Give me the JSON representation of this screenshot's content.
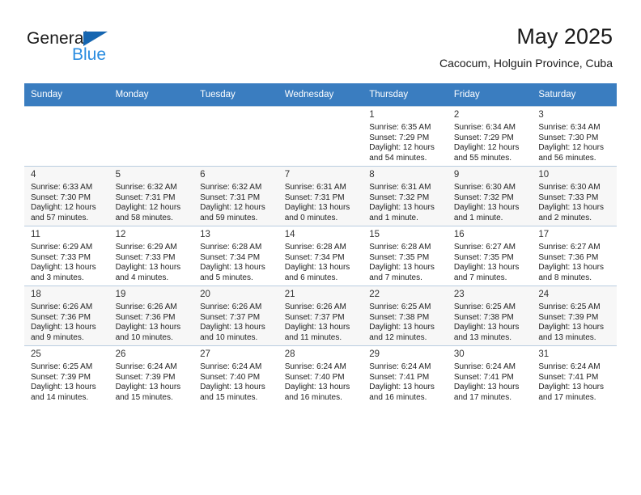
{
  "brand": {
    "line1": "General",
    "line2": "Blue",
    "triangle_color": "#1565b0",
    "blue_color": "#2a8ce0"
  },
  "header": {
    "title": "May 2025",
    "subtitle": "Cacocum, Holguin Province, Cuba"
  },
  "theme": {
    "header_bg": "#3a7dc0",
    "header_text": "#ffffff",
    "row_alt_bg": "#f7f7f7",
    "cell_border": "#b9cde0"
  },
  "weekdays": [
    "Sunday",
    "Monday",
    "Tuesday",
    "Wednesday",
    "Thursday",
    "Friday",
    "Saturday"
  ],
  "weeks": [
    [
      {
        "day": "",
        "info": ""
      },
      {
        "day": "",
        "info": ""
      },
      {
        "day": "",
        "info": ""
      },
      {
        "day": "",
        "info": ""
      },
      {
        "day": "1",
        "info": "Sunrise: 6:35 AM\nSunset: 7:29 PM\nDaylight: 12 hours\nand 54 minutes."
      },
      {
        "day": "2",
        "info": "Sunrise: 6:34 AM\nSunset: 7:29 PM\nDaylight: 12 hours\nand 55 minutes."
      },
      {
        "day": "3",
        "info": "Sunrise: 6:34 AM\nSunset: 7:30 PM\nDaylight: 12 hours\nand 56 minutes."
      }
    ],
    [
      {
        "day": "4",
        "info": "Sunrise: 6:33 AM\nSunset: 7:30 PM\nDaylight: 12 hours\nand 57 minutes."
      },
      {
        "day": "5",
        "info": "Sunrise: 6:32 AM\nSunset: 7:31 PM\nDaylight: 12 hours\nand 58 minutes."
      },
      {
        "day": "6",
        "info": "Sunrise: 6:32 AM\nSunset: 7:31 PM\nDaylight: 12 hours\nand 59 minutes."
      },
      {
        "day": "7",
        "info": "Sunrise: 6:31 AM\nSunset: 7:31 PM\nDaylight: 13 hours\nand 0 minutes."
      },
      {
        "day": "8",
        "info": "Sunrise: 6:31 AM\nSunset: 7:32 PM\nDaylight: 13 hours\nand 1 minute."
      },
      {
        "day": "9",
        "info": "Sunrise: 6:30 AM\nSunset: 7:32 PM\nDaylight: 13 hours\nand 1 minute."
      },
      {
        "day": "10",
        "info": "Sunrise: 6:30 AM\nSunset: 7:33 PM\nDaylight: 13 hours\nand 2 minutes."
      }
    ],
    [
      {
        "day": "11",
        "info": "Sunrise: 6:29 AM\nSunset: 7:33 PM\nDaylight: 13 hours\nand 3 minutes."
      },
      {
        "day": "12",
        "info": "Sunrise: 6:29 AM\nSunset: 7:33 PM\nDaylight: 13 hours\nand 4 minutes."
      },
      {
        "day": "13",
        "info": "Sunrise: 6:28 AM\nSunset: 7:34 PM\nDaylight: 13 hours\nand 5 minutes."
      },
      {
        "day": "14",
        "info": "Sunrise: 6:28 AM\nSunset: 7:34 PM\nDaylight: 13 hours\nand 6 minutes."
      },
      {
        "day": "15",
        "info": "Sunrise: 6:28 AM\nSunset: 7:35 PM\nDaylight: 13 hours\nand 7 minutes."
      },
      {
        "day": "16",
        "info": "Sunrise: 6:27 AM\nSunset: 7:35 PM\nDaylight: 13 hours\nand 7 minutes."
      },
      {
        "day": "17",
        "info": "Sunrise: 6:27 AM\nSunset: 7:36 PM\nDaylight: 13 hours\nand 8 minutes."
      }
    ],
    [
      {
        "day": "18",
        "info": "Sunrise: 6:26 AM\nSunset: 7:36 PM\nDaylight: 13 hours\nand 9 minutes."
      },
      {
        "day": "19",
        "info": "Sunrise: 6:26 AM\nSunset: 7:36 PM\nDaylight: 13 hours\nand 10 minutes."
      },
      {
        "day": "20",
        "info": "Sunrise: 6:26 AM\nSunset: 7:37 PM\nDaylight: 13 hours\nand 10 minutes."
      },
      {
        "day": "21",
        "info": "Sunrise: 6:26 AM\nSunset: 7:37 PM\nDaylight: 13 hours\nand 11 minutes."
      },
      {
        "day": "22",
        "info": "Sunrise: 6:25 AM\nSunset: 7:38 PM\nDaylight: 13 hours\nand 12 minutes."
      },
      {
        "day": "23",
        "info": "Sunrise: 6:25 AM\nSunset: 7:38 PM\nDaylight: 13 hours\nand 13 minutes."
      },
      {
        "day": "24",
        "info": "Sunrise: 6:25 AM\nSunset: 7:39 PM\nDaylight: 13 hours\nand 13 minutes."
      }
    ],
    [
      {
        "day": "25",
        "info": "Sunrise: 6:25 AM\nSunset: 7:39 PM\nDaylight: 13 hours\nand 14 minutes."
      },
      {
        "day": "26",
        "info": "Sunrise: 6:24 AM\nSunset: 7:39 PM\nDaylight: 13 hours\nand 15 minutes."
      },
      {
        "day": "27",
        "info": "Sunrise: 6:24 AM\nSunset: 7:40 PM\nDaylight: 13 hours\nand 15 minutes."
      },
      {
        "day": "28",
        "info": "Sunrise: 6:24 AM\nSunset: 7:40 PM\nDaylight: 13 hours\nand 16 minutes."
      },
      {
        "day": "29",
        "info": "Sunrise: 6:24 AM\nSunset: 7:41 PM\nDaylight: 13 hours\nand 16 minutes."
      },
      {
        "day": "30",
        "info": "Sunrise: 6:24 AM\nSunset: 7:41 PM\nDaylight: 13 hours\nand 17 minutes."
      },
      {
        "day": "31",
        "info": "Sunrise: 6:24 AM\nSunset: 7:41 PM\nDaylight: 13 hours\nand 17 minutes."
      }
    ]
  ]
}
